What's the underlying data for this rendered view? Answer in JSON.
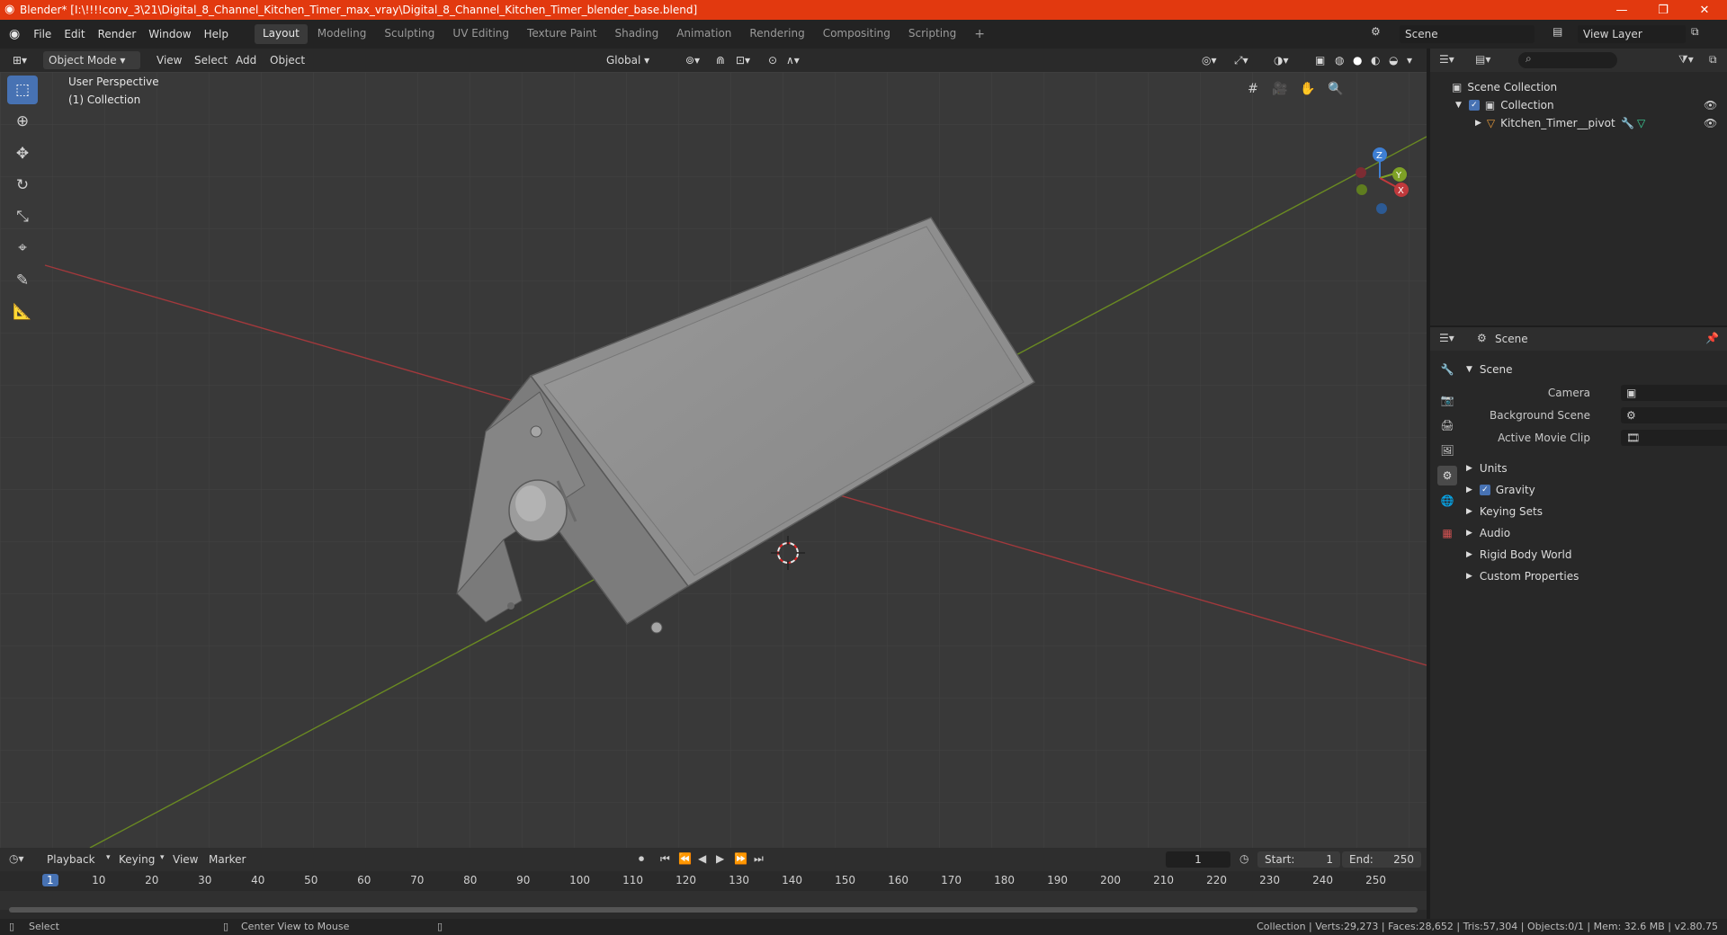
{
  "window": {
    "title": "Blender* [I:\\!!!!conv_3\\21\\Digital_8_Channel_Kitchen_Timer_max_vray\\Digital_8_Channel_Kitchen_Timer_blender_base.blend]",
    "minimize": "—",
    "maximize": "❐",
    "close": "✕"
  },
  "menu": [
    "File",
    "Edit",
    "Render",
    "Window",
    "Help"
  ],
  "workspaces": [
    "Layout",
    "Modeling",
    "Sculpting",
    "UV Editing",
    "Texture Paint",
    "Shading",
    "Animation",
    "Rendering",
    "Compositing",
    "Scripting"
  ],
  "workspace_add": "+",
  "scene_name": "Scene",
  "view_layer": "View Layer",
  "header3d": {
    "mode": "Object Mode",
    "menus": [
      "View",
      "Select",
      "Add",
      "Object"
    ],
    "transform": "Global"
  },
  "viewport": {
    "perspective": "User Perspective",
    "collection": "(1) Collection",
    "gizmo": {
      "x": "X",
      "y": "Y",
      "z": "Z"
    }
  },
  "outliner": {
    "root": "Scene Collection",
    "collection": "Collection",
    "object": "Kitchen_Timer__pivot"
  },
  "properties": {
    "header": "Scene",
    "section": "Scene",
    "camera_label": "Camera",
    "background_label": "Background Scene",
    "movieclip_label": "Active Movie Clip",
    "subsections": [
      "Units",
      "Gravity",
      "Keying Sets",
      "Audio",
      "Rigid Body World",
      "Custom Properties"
    ]
  },
  "timeline": {
    "menus": [
      "Playback",
      "Keying",
      "View",
      "Marker"
    ],
    "current_frame": "1",
    "start_label": "Start:",
    "start": "1",
    "end_label": "End:",
    "end": "250",
    "ruler": [
      "1",
      "10",
      "20",
      "30",
      "40",
      "50",
      "60",
      "70",
      "80",
      "90",
      "100",
      "110",
      "120",
      "130",
      "140",
      "150",
      "160",
      "170",
      "180",
      "190",
      "200",
      "210",
      "220",
      "230",
      "240",
      "250"
    ]
  },
  "status": {
    "left": "Select",
    "middle": "Center View to Mouse",
    "right": "Collection | Verts:29,273 | Faces:28,652 | Tris:57,304 | Objects:0/1 | Mem: 32.6 MB | v2.80.75"
  },
  "colors": {
    "titlebar": "#e2390f",
    "accent": "#4772b3",
    "x_axis": "#c0393c",
    "y_axis": "#7ea126",
    "z_axis": "#3e7fd4"
  }
}
